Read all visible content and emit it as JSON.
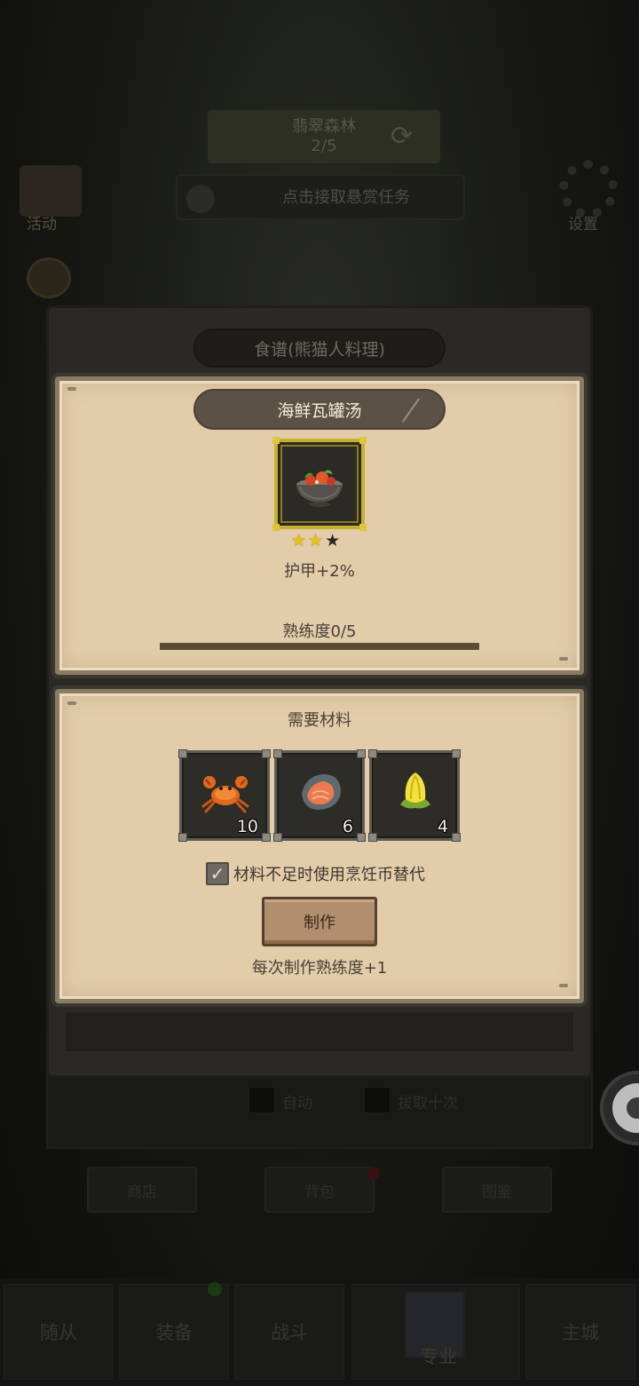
{
  "background": {
    "area_name": "翡翠森林",
    "area_progress": "2/5",
    "bounty_text": "点击接取悬赏任务",
    "activity_label": "活动",
    "settings_label": "设置",
    "auto_label": "自动",
    "ten_label": "拔取十次",
    "small_buttons": [
      "商店",
      "背包",
      "图鉴"
    ],
    "nav_items": [
      "随从",
      "装备",
      "战斗",
      "专业",
      "主城"
    ]
  },
  "dialog": {
    "header_title": "食谱(熊猫人料理)",
    "recipe": {
      "name": "海鲜瓦罐汤",
      "icon": "seafood-pot-icon",
      "stars_total": 3,
      "stars_filled": 2,
      "effect": "护甲+2%",
      "proficiency_label": "熟练度0/5",
      "proficiency_fraction": 0
    },
    "materials": {
      "title": "需要材料",
      "items": [
        {
          "icon": "crab-icon",
          "count": "10"
        },
        {
          "icon": "fish-steak-icon",
          "count": "6"
        },
        {
          "icon": "yellow-flower-icon",
          "count": "4"
        }
      ],
      "substitute_label": "材料不足时使用烹饪币替代",
      "substitute_checked": true
    },
    "make_button": "制作",
    "make_hint": "每次制作熟练度+1"
  },
  "colors": {
    "parchment": "#e3ccaa",
    "banner": "#5b5145",
    "gold_frame": "#c9b02c",
    "button": "#b18e6e"
  }
}
